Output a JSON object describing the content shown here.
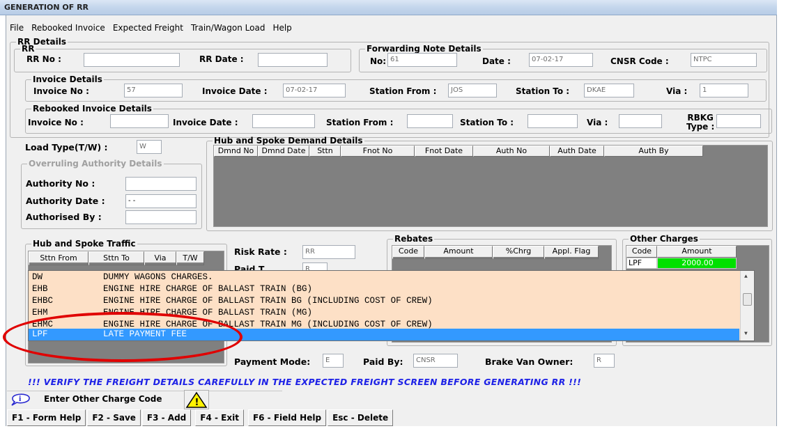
{
  "window": {
    "title": "GENERATION OF RR"
  },
  "menu": [
    "File",
    "Rebooked Invoice",
    "Expected Freight",
    "Train/Wagon Load",
    "Help"
  ],
  "rr_details": {
    "group_label": "RR Details",
    "rr": {
      "group_label": "RR",
      "rr_no_label": "RR No :",
      "rr_no": "",
      "rr_date_label": "RR Date :",
      "rr_date": ""
    },
    "forwarding_note": {
      "group_label": "Forwarding Note Details",
      "no_label": "No:",
      "no": "61",
      "date_label": "Date :",
      "date": "07-02-17",
      "cnsr_label": "CNSR Code :",
      "cnsr_code": "NTPC"
    },
    "invoice": {
      "group_label": "Invoice Details",
      "no_label": "Invoice No :",
      "no": "57",
      "date_label": "Invoice Date :",
      "date": "07-02-17",
      "from_label": "Station From :",
      "from": "JOS",
      "to_label": "Station To :",
      "to": "DKAE",
      "via_label": "Via :",
      "via": "1"
    },
    "rebooked": {
      "group_label": "Rebooked Invoice Details",
      "no_label": "Invoice No :",
      "no": "",
      "date_label": "Invoice Date :",
      "date": "",
      "from_label": "Station From :",
      "from": "",
      "to_label": "Station To :",
      "to": "",
      "via_label": "Via :",
      "via": "",
      "rbkg_label_1": "RBKG",
      "rbkg_label_2": "Type :",
      "rbkg_type": ""
    }
  },
  "load_type": {
    "label": "Load Type(T/W) :",
    "value": "W"
  },
  "overruling": {
    "group_label": "Overruling Authority Details",
    "authority_no_label": "Authority No :",
    "authority_no": "",
    "authority_date_label": "Authority Date :",
    "authority_date": " - -",
    "authorised_by_label": "Authorised By :",
    "authorised_by": ""
  },
  "hub_spoke_demand": {
    "group_label": "Hub and Spoke Demand Details",
    "columns": [
      "Dmnd No",
      "Dmnd Date",
      "Sttn",
      "Fnot No",
      "Fnot Date",
      "Auth No",
      "Auth Date",
      "Auth By"
    ]
  },
  "hub_spoke_traffic": {
    "group_label": "Hub and Spoke Traffic",
    "columns": [
      "Sttn From",
      "Sttn To",
      "Via",
      "T/W"
    ]
  },
  "risk_rate": {
    "label": "Risk Rate :",
    "value": "RR",
    "paid_label": "Paid T",
    "paid_value": "R"
  },
  "rebates": {
    "group_label": "Rebates",
    "columns": [
      "Code",
      "Amount",
      "%Chrg",
      "Appl. Flag"
    ]
  },
  "other_charges": {
    "group_label": "Other Charges",
    "columns": [
      "Code",
      "Amount"
    ],
    "rows": [
      {
        "code": "LPF",
        "amount": "2000.00"
      }
    ]
  },
  "charge_dropdown": {
    "items": [
      {
        "code": "DW",
        "desc": "DUMMY WAGONS CHARGES."
      },
      {
        "code": "EHB",
        "desc": "ENGINE HIRE CHARGE OF BALLAST TRAIN (BG)"
      },
      {
        "code": "EHBC",
        "desc": "ENGINE HIRE CHARGE OF BALLAST TRAIN BG (INCLUDING COST OF CREW)"
      },
      {
        "code": "EHM",
        "desc": "ENGINE HIRE CHARGE OF BALLAST TRAIN (MG)"
      },
      {
        "code": "EHMC",
        "desc": "ENGINE HIRE CHARGE OF BALLAST TRAIN MG (INCLUDING COST OF CREW)"
      },
      {
        "code": "LPF",
        "desc": "LATE PAYMENT FEE"
      }
    ],
    "selected_index": 5
  },
  "payment": {
    "mode_label": "Payment Mode:",
    "mode": "E",
    "paid_by_label": "Paid By:",
    "paid_by": "CNSR",
    "brake_van_label": "Brake Van Owner:",
    "brake_van": "R"
  },
  "warning_text": "!!! VERIFY THE FREIGHT DETAILS CAREFULLY IN THE EXPECTED FREIGHT SCREEN BEFORE GENERATING RR !!!",
  "status": {
    "text": "Enter Other Charge Code",
    "info_icon": "info-icon",
    "warning_icon": "warning-icon"
  },
  "function_keys": [
    "F1 - Form Help",
    "F2 - Save",
    "F3 - Add",
    "F4 - Exit",
    "F6 - Field Help",
    "Esc - Delete"
  ],
  "colors": {
    "selected": "#3399ff",
    "dropdown_bg": "#fde0c6",
    "warning_text": "#1d21e6",
    "highlight_ellipse": "#e00000",
    "amount_cell": "#00e000"
  }
}
